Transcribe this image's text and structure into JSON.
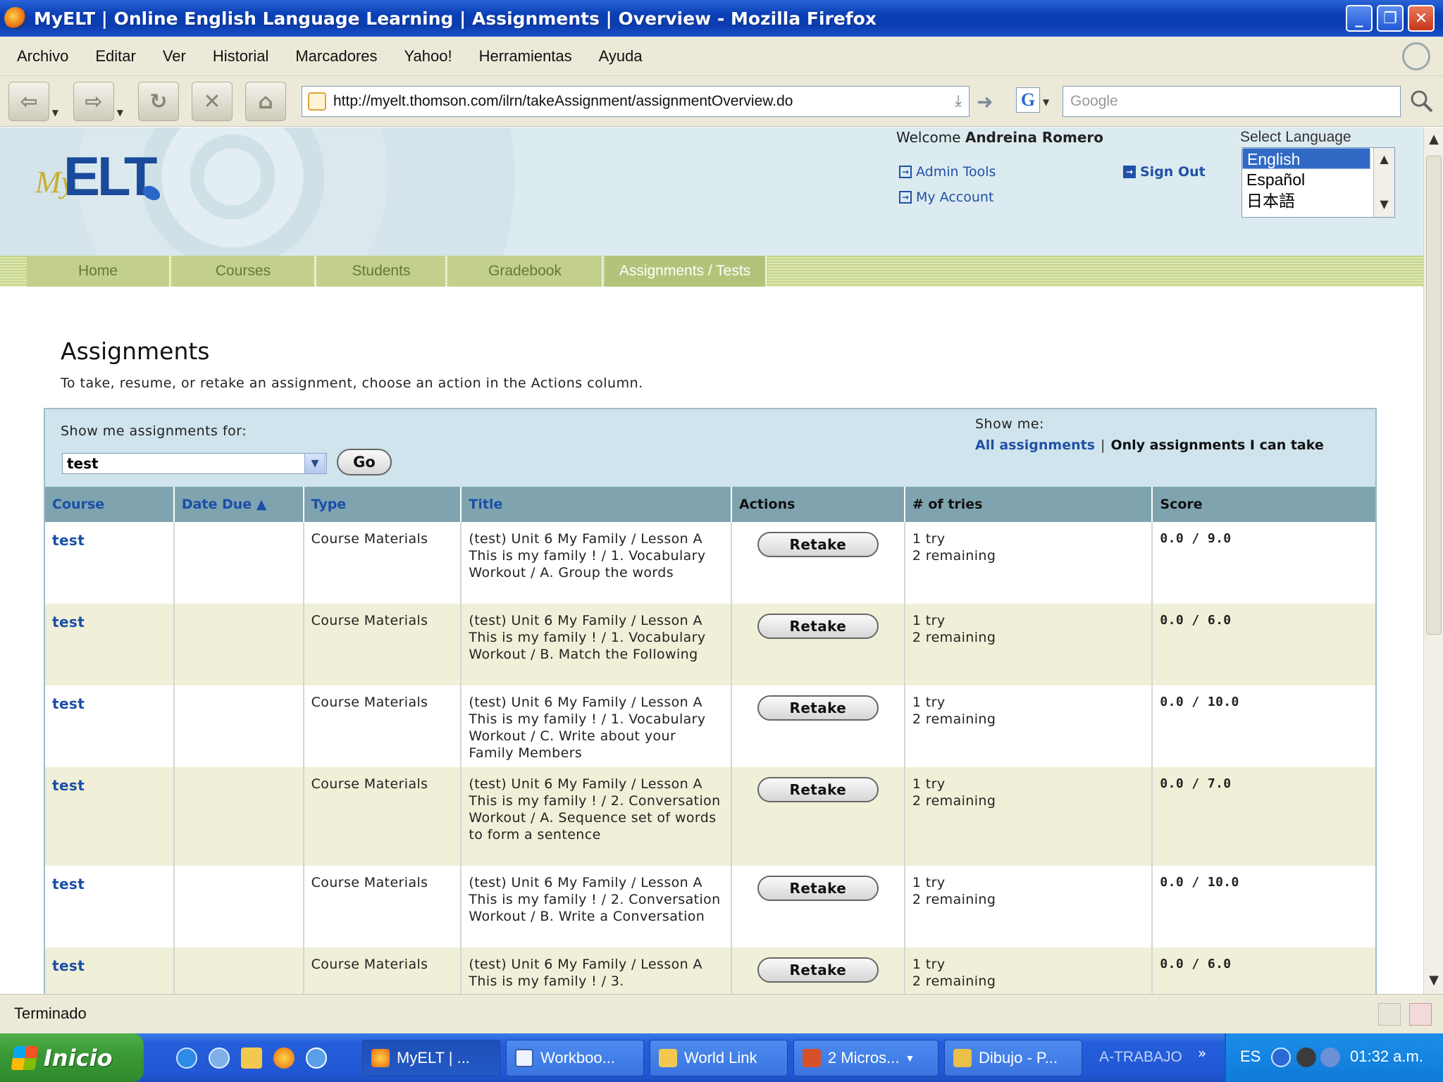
{
  "window": {
    "title": "MyELT | Online English Language Learning | Assignments | Overview - Mozilla Firefox"
  },
  "menubar": {
    "items": [
      "Archivo",
      "Editar",
      "Ver",
      "Historial",
      "Marcadores",
      "Yahoo!",
      "Herramientas",
      "Ayuda"
    ]
  },
  "toolbar": {
    "url": "http://myelt.thomson.com/ilrn/takeAssignment/assignmentOverview.do",
    "search_placeholder": "Google"
  },
  "header": {
    "welcome_prefix": "Welcome",
    "user_name": "Andreina Romero",
    "admin_tools": "Admin Tools",
    "my_account": "My Account",
    "sign_out": "Sign Out",
    "select_language": "Select Language",
    "languages": [
      "English",
      "Español",
      "日本語"
    ],
    "selected_language": "English"
  },
  "nav": {
    "tabs": [
      "Home",
      "Courses",
      "Students",
      "Gradebook",
      "Assignments / Tests"
    ],
    "active": "Assignments / Tests"
  },
  "main": {
    "heading": "Assignments",
    "intro": "To take, resume, or retake an assignment, choose an action in the Actions column."
  },
  "filter": {
    "label": "Show me assignments for:",
    "selected_course": "test",
    "go_label": "Go",
    "show_me_label": "Show me:",
    "all_assignments": "All assignments",
    "separator": "|",
    "only_assignments": "Only assignments I can take"
  },
  "table": {
    "headers": [
      "Course",
      "Date Due ▲",
      "Type",
      "Title",
      "Actions",
      "# of tries",
      "Score"
    ],
    "rows": [
      {
        "course": "test",
        "date_due": "",
        "type": "Course Materials",
        "title": "(test) Unit 6 My Family / Lesson A This is my family ! / 1. Vocabulary Workout / A. Group the words",
        "action": "Retake",
        "tries": "1 try",
        "remaining": "2 remaining",
        "score": "0.0 / 9.0"
      },
      {
        "course": "test",
        "date_due": "",
        "type": "Course Materials",
        "title": "(test) Unit 6 My Family / Lesson A This is my family ! / 1. Vocabulary Workout / B. Match the Following",
        "action": "Retake",
        "tries": "1 try",
        "remaining": "2 remaining",
        "score": "0.0 / 6.0"
      },
      {
        "course": "test",
        "date_due": "",
        "type": "Course Materials",
        "title": "(test) Unit 6 My Family / Lesson A This is my family ! / 1. Vocabulary Workout / C. Write about your Family Members",
        "action": "Retake",
        "tries": "1 try",
        "remaining": "2 remaining",
        "score": "0.0 / 10.0"
      },
      {
        "course": "test",
        "date_due": "",
        "type": "Course Materials",
        "title": "(test) Unit 6 My Family / Lesson A This is my family ! / 2. Conversation Workout / A. Sequence set of words to form a sentence",
        "action": "Retake",
        "tries": "1 try",
        "remaining": "2 remaining",
        "score": "0.0 / 7.0"
      },
      {
        "course": "test",
        "date_due": "",
        "type": "Course Materials",
        "title": "(test) Unit 6 My Family / Lesson A This is my family ! / 2. Conversation Workout / B. Write a Conversation",
        "action": "Retake",
        "tries": "1 try",
        "remaining": "2 remaining",
        "score": "0.0 / 10.0"
      },
      {
        "course": "test",
        "date_due": "",
        "type": "Course Materials",
        "title": "(test) Unit 6 My Family / Lesson A This is my family ! / 3.",
        "action": "Retake",
        "tries": "1 try",
        "remaining": "2 remaining",
        "score": "0.0 / 6.0"
      }
    ]
  },
  "statusbar": {
    "text": "Terminado"
  },
  "taskbar": {
    "start_label": "Inicio",
    "tasks": [
      "MyELT | ...",
      "Workboo...",
      "World Link",
      "2 Micros...",
      "Dibujo - P..."
    ],
    "folder_label": "A-TRABAJO",
    "chevron": "»",
    "lang": "ES",
    "clock": "01:32 a.m."
  },
  "colors": {
    "link_blue": "#2050a8",
    "nav_green": "#c2d08c",
    "header_blue": "#7fa4b0",
    "xp_blue": "#245edb"
  }
}
